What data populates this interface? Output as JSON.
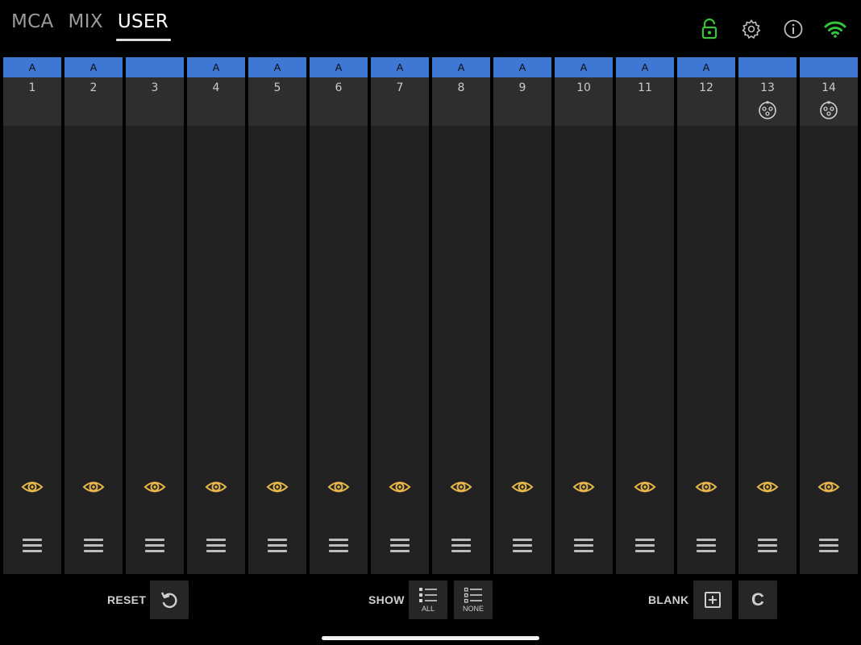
{
  "tabs": [
    {
      "label": "MCA",
      "active": false
    },
    {
      "label": "MIX",
      "active": false
    },
    {
      "label": "USER",
      "active": true
    }
  ],
  "top_icons": [
    {
      "icon": "unlock-icon",
      "color": "#39c23a"
    },
    {
      "icon": "gear-icon",
      "color": "#bdbdbd"
    },
    {
      "icon": "info-icon",
      "color": "#bdbdbd"
    },
    {
      "icon": "wifi-icon",
      "color": "#33c63a"
    }
  ],
  "channels": [
    {
      "label": "A",
      "number": "1",
      "xlr": false
    },
    {
      "label": "A",
      "number": "2",
      "xlr": false
    },
    {
      "label": "",
      "number": "3",
      "xlr": false
    },
    {
      "label": "A",
      "number": "4",
      "xlr": false
    },
    {
      "label": "A",
      "number": "5",
      "xlr": false
    },
    {
      "label": "A",
      "number": "6",
      "xlr": false
    },
    {
      "label": "A",
      "number": "7",
      "xlr": false
    },
    {
      "label": "A",
      "number": "8",
      "xlr": false
    },
    {
      "label": "A",
      "number": "9",
      "xlr": false
    },
    {
      "label": "A",
      "number": "10",
      "xlr": false
    },
    {
      "label": "A",
      "number": "11",
      "xlr": false
    },
    {
      "label": "A",
      "number": "12",
      "xlr": false
    },
    {
      "label": "",
      "number": "13",
      "xlr": true
    },
    {
      "label": "",
      "number": "14",
      "xlr": true
    }
  ],
  "colors": {
    "header_blue": "#3f78d4",
    "eye_yellow": "#e8b94a",
    "strip_bg": "#222222",
    "number_bg": "#2e2e2e"
  },
  "bottom": {
    "reset_label": "RESET",
    "show_label": "SHOW",
    "show_all_label": "ALL",
    "show_none_label": "NONE",
    "blank_label": "BLANK",
    "c_label": "C"
  }
}
